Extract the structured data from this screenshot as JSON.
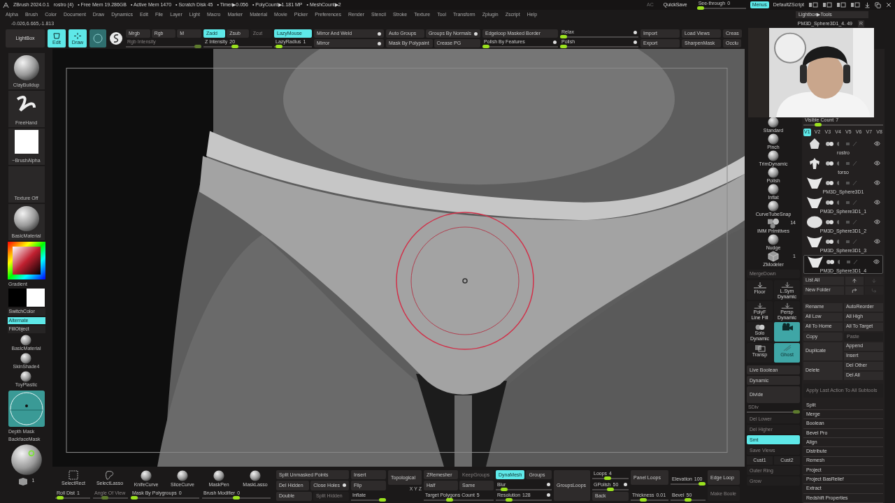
{
  "title_bar": {
    "app": "ZBrush 2024.0.1",
    "document": "rostro (4)",
    "stats": [
      "• Free Mem 19.286GB",
      "• Active Mem 1470",
      "• Scratch Disk 45",
      "• Timer▶0.056",
      "• PolyCount▶1.181 MP",
      "• MeshCount▶2"
    ],
    "ac": "AC",
    "quicksave": "QuickSave",
    "see_through": {
      "label": "See-through",
      "value": "0",
      "level": 0
    },
    "menus": {
      "label": "Menus",
      "selected": true
    },
    "script": "DefaultZScript"
  },
  "menu": [
    "Alpha",
    "Brush",
    "Color",
    "Document",
    "Draw",
    "Dynamics",
    "Edit",
    "File",
    "Layer",
    "Light",
    "Macro",
    "Marker",
    "Material",
    "Movie",
    "Picker",
    "Preferences",
    "Render",
    "Stencil",
    "Stroke",
    "Texture",
    "Tool",
    "Transform",
    "Zplugin",
    "Zscript",
    "Help"
  ],
  "lightbox_tools": "Lightbox▶Tools",
  "coordinates": "-0.026,6.665,-1.813",
  "current_tool": {
    "name": "PM3D_Sphere3D1_4. 49",
    "r": "R"
  },
  "top_toolbar": {
    "lightbox": "LightBox",
    "modes": [
      {
        "label": "Edit",
        "selected": true
      },
      {
        "label": "Draw",
        "selected": true
      }
    ],
    "columns": [
      [
        [
          {
            "kind": "button",
            "label": "Mrgb",
            "selected": false
          },
          {
            "kind": "button",
            "label": "Rgb",
            "selected": false
          },
          {
            "kind": "button",
            "label": "M",
            "selected": false
          }
        ],
        [
          {
            "kind": "slider",
            "label": "Rgb Intensity",
            "disabled": true,
            "level": 1
          }
        ]
      ],
      [
        [
          {
            "kind": "button",
            "label": "Zadd",
            "selected": true
          },
          {
            "kind": "button",
            "label": "Zsub",
            "selected": false
          },
          {
            "kind": "button",
            "label": "Zcut",
            "selected": false,
            "disabled": true
          }
        ],
        [
          {
            "kind": "slider",
            "label": "Z Intensity",
            "value": "20",
            "level": 0.45
          }
        ]
      ],
      [
        [
          {
            "kind": "button",
            "label": "LazyMouse",
            "selected": true
          }
        ],
        [
          {
            "kind": "slider",
            "label": "LazyRadius",
            "value": "1",
            "level": 0.05
          }
        ]
      ],
      [
        [
          {
            "kind": "button",
            "label": "Mirror And Weld",
            "toggle": true
          }
        ],
        [
          {
            "kind": "button",
            "label": "Mirror",
            "toggle": true
          }
        ]
      ],
      [
        [
          {
            "kind": "button",
            "label": "Auto Groups"
          },
          {
            "kind": "button",
            "label": "Groups By Normals",
            "toggle": true
          }
        ],
        [
          {
            "kind": "button",
            "label": "Mask By Polypaint"
          },
          {
            "kind": "button",
            "label": "Crease PG"
          }
        ]
      ],
      [
        [
          {
            "kind": "button",
            "label": "Edgeloop Masked Border"
          }
        ],
        [
          {
            "kind": "slider",
            "label": "Polish By Features",
            "level": 0,
            "toggle": true
          }
        ]
      ],
      [
        [
          {
            "kind": "slider",
            "label": "Relax",
            "level": 0,
            "toggle": true
          }
        ],
        [
          {
            "kind": "slider",
            "label": "Polish",
            "level": 0,
            "toggle": true
          }
        ]
      ],
      [
        [
          {
            "kind": "button",
            "label": "Import"
          }
        ],
        [
          {
            "kind": "button",
            "label": "Export"
          }
        ]
      ],
      [
        [
          {
            "kind": "button",
            "label": "Load Views"
          }
        ],
        [
          {
            "kind": "button",
            "label": "SharpenMask"
          }
        ]
      ],
      [
        [
          {
            "kind": "button",
            "label": "Creas"
          }
        ],
        [
          {
            "kind": "button",
            "label": "Occlu"
          }
        ]
      ]
    ]
  },
  "left_shelf": {
    "brush": "ClayBuildup",
    "stroke": "FreeHand",
    "alpha": "~BrushAlpha",
    "texture": "Texture Off",
    "material": "BasicMaterial",
    "gradient": "Gradient",
    "switch_color": "SwitchColor",
    "alternate": {
      "label": "Alternate",
      "selected": true
    },
    "fill_object": "FillObject",
    "materials": [
      "BasicMaterial",
      "SkinShade4",
      "ToyPlastic"
    ],
    "depth_mask": "Depth Mask",
    "backface_mask": "BackfaceMask",
    "count": "1"
  },
  "brushes": [
    {
      "label": "Standard"
    },
    {
      "label": "Pinch"
    },
    {
      "label": "TrimDynamic"
    },
    {
      "label": "Polish"
    },
    {
      "label": "Inflat"
    },
    {
      "label": "CurveTubeSnap"
    },
    {
      "label": "IMM Primitives",
      "count": "14"
    },
    {
      "label": "Nudge"
    },
    {
      "label": "ZModeler",
      "count": "1"
    }
  ],
  "merge_down": {
    "label": "MergeDown",
    "disabled": true
  },
  "view_buttons": [
    {
      "label": "Floor",
      "selected": false
    },
    {
      "label": "L.Sym",
      "caption": "Dynamic",
      "selected": false
    },
    {
      "label": "PolyF",
      "caption": "Line Fill",
      "selected": false
    },
    {
      "label": "Persp",
      "caption": "Dynamic",
      "selected": false
    },
    {
      "label": "Solo",
      "caption": "Dynamic",
      "selected": false
    },
    {
      "selected": true
    },
    {
      "label": "Transp",
      "selected": false
    },
    {
      "label": "Ghost",
      "selected": true
    }
  ],
  "geometry": [
    {
      "kind": "button",
      "label": "Live Boolean"
    },
    {
      "kind": "button",
      "label": "Dynamic"
    },
    {
      "kind": "tall",
      "label": "Divide"
    },
    {
      "kind": "slider",
      "label": "SDiv",
      "disabled": true,
      "level": 1
    },
    {
      "kind": "button",
      "label": "Del Lower",
      "disabled": true
    },
    {
      "kind": "button",
      "label": "Del Higher",
      "disabled": true
    },
    {
      "kind": "button",
      "label": "Smt",
      "selected": true
    },
    {
      "kind": "button",
      "label": "Save Views",
      "disabled": true
    },
    {
      "kind": "pair",
      "labels": [
        "Cust1",
        "Cust2"
      ]
    },
    {
      "kind": "button",
      "label": "Outer Ring",
      "disabled": true
    },
    {
      "kind": "button",
      "label": "Grow",
      "disabled": true
    }
  ],
  "subtool": {
    "visible_count": {
      "label": "Visible Count",
      "value": "7",
      "level": 0.15
    },
    "versions": [
      {
        "label": "V1",
        "selected": true
      },
      {
        "label": "V2",
        "selected": false
      },
      {
        "label": "V3",
        "selected": false
      },
      {
        "label": "V4",
        "selected": false
      },
      {
        "label": "V5",
        "selected": false
      },
      {
        "label": "V6",
        "selected": false
      },
      {
        "label": "V7",
        "selected": false
      },
      {
        "label": "V8",
        "selected": false
      }
    ],
    "items": [
      {
        "name": "rostro",
        "selected": false,
        "visible": true
      },
      {
        "name": "torso",
        "selected": false,
        "visible": true
      },
      {
        "name": "PM3D_Sphere3D1",
        "selected": false,
        "visible": true
      },
      {
        "name": "PM3D_Sphere3D1_1",
        "selected": false,
        "visible": true
      },
      {
        "name": "PM3D_Sphere3D1_2",
        "selected": false,
        "visible": true
      },
      {
        "name": "PM3D_Sphere3D1_3",
        "selected": false,
        "visible": true
      },
      {
        "name": "PM3D_Sphere3D1_4",
        "selected": true,
        "visible": true
      }
    ],
    "list_all": "List All",
    "new_folder": "New Folder",
    "pairs": [
      [
        "Rename",
        "AutoReorder"
      ],
      [
        "All Low",
        "All High"
      ],
      [
        "All To Home",
        "All To Target"
      ]
    ],
    "copy": {
      "label": "Copy",
      "disabled": false
    },
    "paste": {
      "label": "Paste",
      "disabled": true
    },
    "duplicate": "Duplicate",
    "duplicate_options": [
      "Append",
      "Insert"
    ],
    "delete": "Delete",
    "delete_options": [
      "Del Other",
      "Del All"
    ],
    "apply_all": {
      "label": "Apply Last Action To All Subtools",
      "disabled": true
    },
    "sections": [
      "Split",
      "Merge",
      "Boolean",
      "Bevel Pro",
      "Align",
      "Distribute",
      "Remesh",
      "Project",
      "Project BasRelief",
      "Extract",
      "Redshift Properties"
    ]
  },
  "bottom_bar": {
    "tools": [
      "SelectRect",
      "SelectLasso",
      "KnifeCurve",
      "SliceCurve",
      "MaskPen",
      "MaskLasso"
    ],
    "tool_sliders": [
      {
        "label": "Roll Dist",
        "value": "1",
        "level": 0.05
      },
      {
        "label": "Angle Of View",
        "disabled": true,
        "level": 0.3
      },
      {
        "label": "Mask By Polygroups",
        "value": "0",
        "level": 0
      },
      {
        "label": "Brush Modifier",
        "value": "0",
        "level": 0.5
      }
    ],
    "columns": [
      [
        [
          {
            "kind": "button",
            "label": "Split Unmasked Points"
          }
        ],
        [
          {
            "kind": "button",
            "label": "Del Hidden"
          },
          {
            "kind": "button",
            "label": "Close Holes",
            "toggle": true
          }
        ],
        [
          {
            "kind": "button",
            "label": "Double"
          },
          {
            "kind": "button",
            "label": "Split Hidden",
            "disabled": true
          }
        ]
      ],
      [
        [
          {
            "kind": "button",
            "label": "Insert"
          }
        ],
        [
          {
            "kind": "button",
            "label": "Flip"
          }
        ],
        [
          {
            "kind": "slider",
            "label": "Inflate",
            "level": 1
          }
        ]
      ],
      [
        [
          {
            "kind": "tall",
            "label": "Topological"
          }
        ],
        [
          {
            "kind": "label",
            "label": "X Y Z"
          }
        ]
      ],
      [
        [
          {
            "kind": "button",
            "label": "ZRemesher"
          },
          {
            "kind": "button",
            "label": "KeepGroups",
            "disabled": true
          }
        ],
        [
          {
            "kind": "button",
            "label": "Half"
          },
          {
            "kind": "button",
            "label": "Same"
          }
        ],
        [
          {
            "kind": "slider",
            "label": "Target Polygons Count",
            "value": "5",
            "level": 0.35
          }
        ]
      ],
      [
        [
          {
            "kind": "tall",
            "label": "DynaMesh",
            "selected": true
          },
          {
            "kind": "button",
            "label": "Groups"
          }
        ],
        [
          {
            "kind": "slider",
            "label": "Blur",
            "level": 0.1,
            "toggle": true
          }
        ],
        [
          {
            "kind": "slider",
            "label": "Resolution",
            "value": "128",
            "level": 0.2,
            "toggle": true
          }
        ]
      ],
      [
        [
          {
            "kind": "tall",
            "label": "GroupsLoops"
          }
        ]
      ],
      [
        [
          {
            "kind": "slider",
            "label": "Loops",
            "value": "4",
            "level": 0.4
          }
        ],
        [
          {
            "kind": "slider",
            "label": "GPolish",
            "value": "50",
            "level": 0.5,
            "toggle": true
          }
        ],
        [
          {
            "kind": "button",
            "label": "Back"
          }
        ]
      ],
      [
        [
          {
            "kind": "tall",
            "label": "Panel Loops"
          }
        ],
        [
          {
            "kind": "slider",
            "label": "Thickness",
            "value": "0.01",
            "level": 0.3
          }
        ]
      ],
      [
        [
          {
            "kind": "slider",
            "label": "Elevation",
            "value": "100",
            "level": 1
          }
        ],
        [
          {
            "kind": "slider",
            "label": "Bevel",
            "value": "50",
            "level": 0.5
          }
        ]
      ],
      [
        [
          {
            "kind": "tall",
            "label": "Edge Loop"
          }
        ],
        [
          {
            "kind": "button",
            "label": "Make Boole",
            "disabled": true
          }
        ]
      ]
    ]
  }
}
